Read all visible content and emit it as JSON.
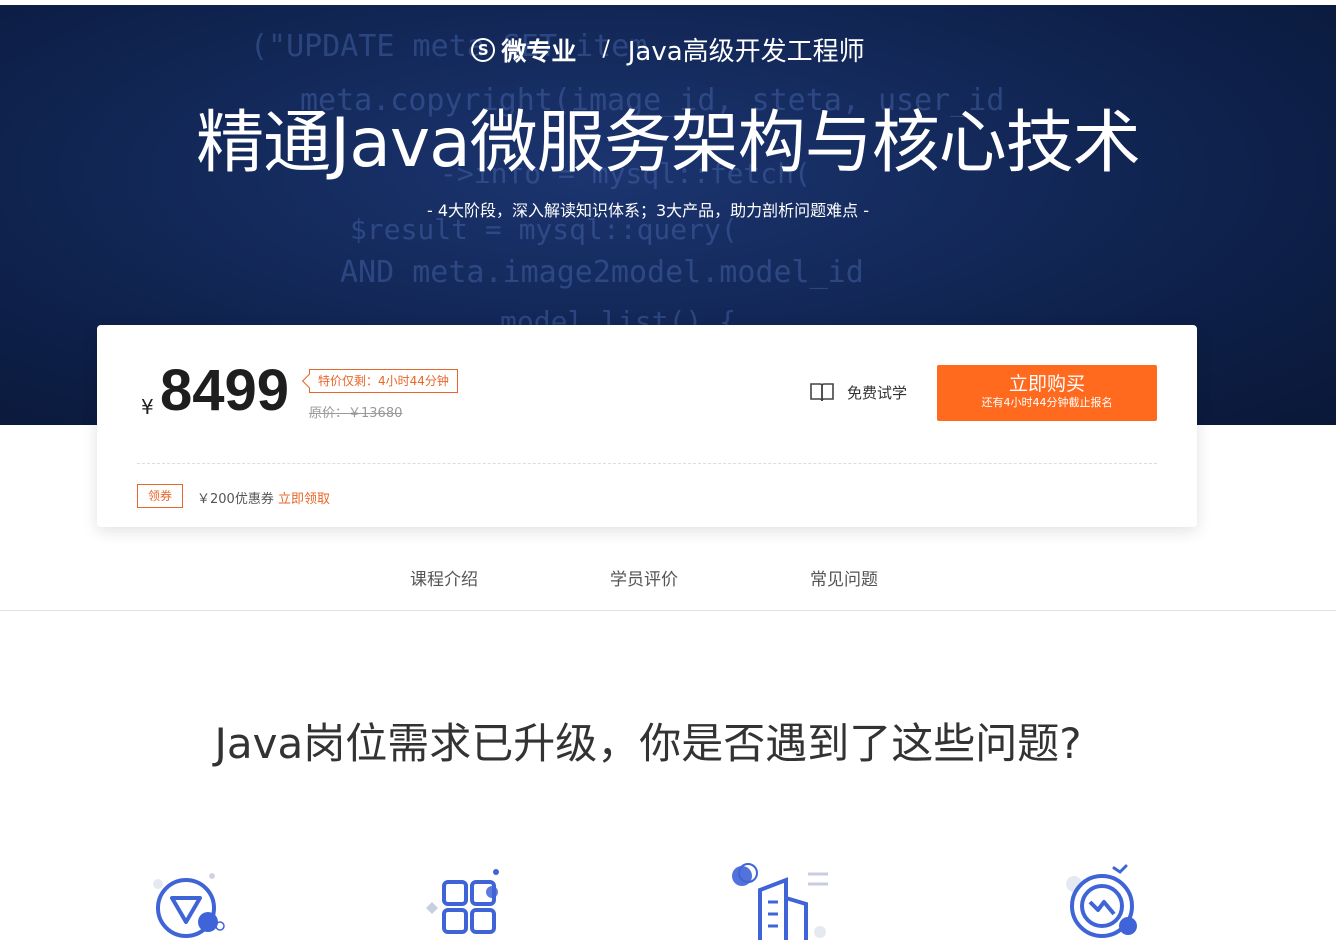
{
  "header": {
    "brand": "微专业",
    "brand_mark": "S",
    "separator": "/",
    "category": "Java高级开发工程师",
    "title": "精通Java微服务架构与核心技术",
    "subtitle": "- 4大阶段，深入解读知识体系；3大产品，助力剖析问题难点 -",
    "background_code": [
      "(\"UPDATE meta SET item",
      "meta.copyright(image_id, steta, user_id",
      "->info = mysql::fetch(",
      "$result = mysql::query(",
      "AND meta.image2model.model_id",
      "model.list() {"
    ]
  },
  "pricing": {
    "currency": "¥",
    "price": "8499",
    "promo": "特价仅剩：4小时44分钟",
    "original_price": "原价：￥13680",
    "trial_label": "免费试学",
    "buy_label": "立即购买",
    "buy_sublabel": "还有4小时44分钟截止报名",
    "coupon_badge": "领券",
    "coupon_text": "￥200优惠券",
    "coupon_link": "立即领取",
    "accent_color": "#ff6a1f"
  },
  "tabs": [
    {
      "label": "课程介绍"
    },
    {
      "label": "学员评价"
    },
    {
      "label": "常见问题"
    }
  ],
  "section": {
    "title": "Java岗位需求已升级，你是否遇到了这些问题?"
  },
  "features": [
    {
      "icon": "triangle-circle-icon"
    },
    {
      "icon": "grid-blocks-icon"
    },
    {
      "icon": "building-icon"
    },
    {
      "icon": "refresh-chart-icon"
    }
  ]
}
